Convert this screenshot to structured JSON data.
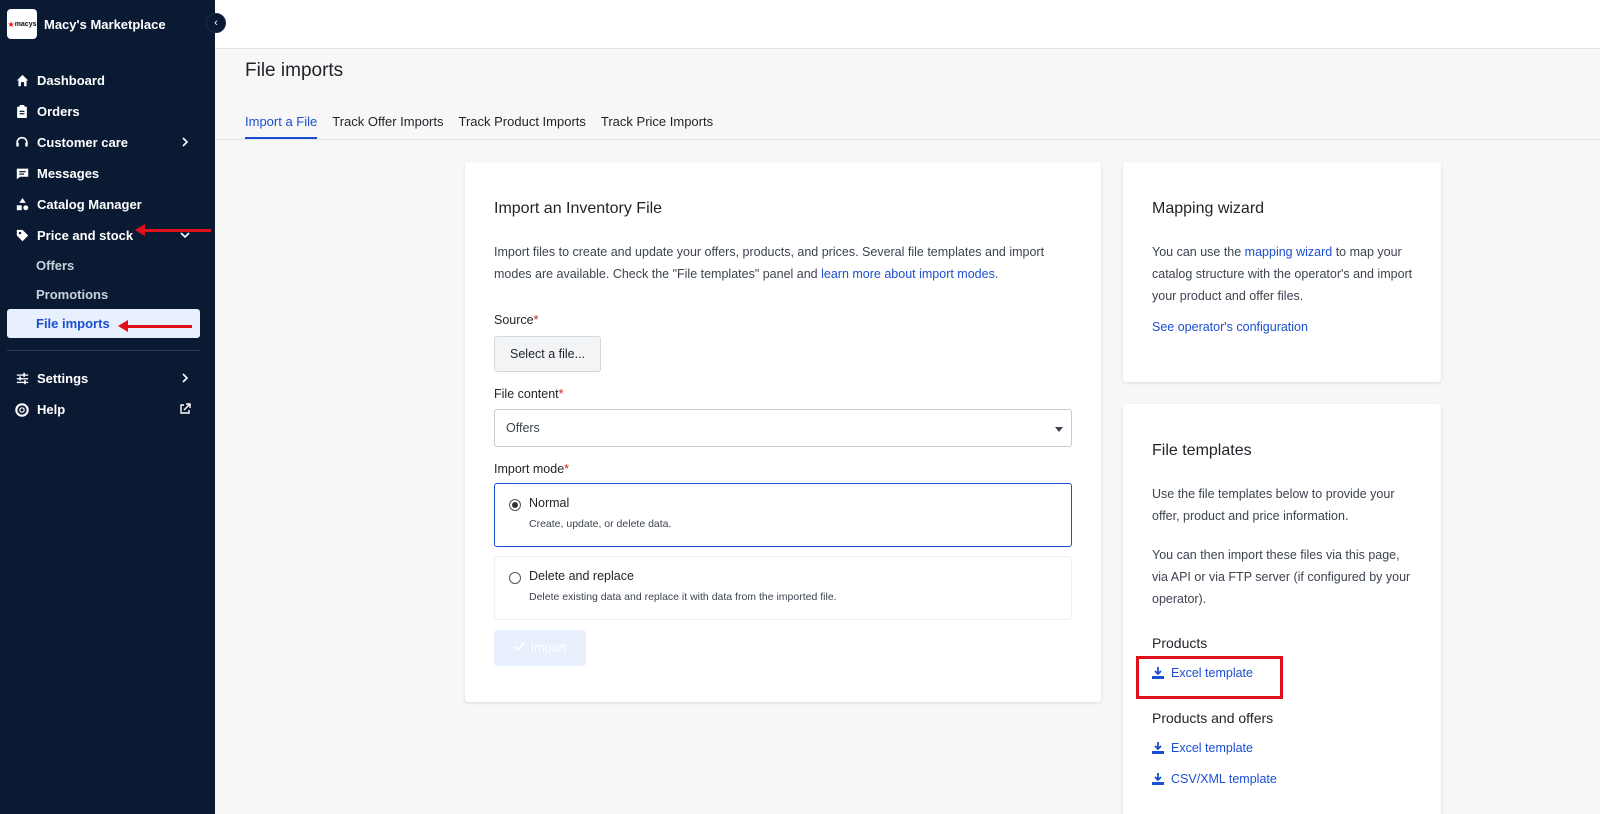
{
  "sidebar": {
    "brand_name": "Macy's Marketplace",
    "logo_text": "macys",
    "collapse_glyph": "‹",
    "items": [
      {
        "label": "Dashboard",
        "icon": "home-icon"
      },
      {
        "label": "Orders",
        "icon": "clipboard-icon"
      },
      {
        "label": "Customer care",
        "icon": "headset-icon",
        "has_chevron": true
      },
      {
        "label": "Messages",
        "icon": "chat-icon"
      },
      {
        "label": "Catalog Manager",
        "icon": "shapes-icon"
      },
      {
        "label": "Price and stock",
        "icon": "tag-icon",
        "expanded": true
      }
    ],
    "sub_items": [
      {
        "label": "Offers"
      },
      {
        "label": "Promotions"
      },
      {
        "label": "File imports",
        "active": true
      }
    ],
    "bottom_items": [
      {
        "label": "Settings",
        "icon": "sliders-icon",
        "has_chevron": true
      },
      {
        "label": "Help",
        "icon": "lifebuoy-icon",
        "external": true
      }
    ]
  },
  "page": {
    "title": "File imports",
    "tabs": [
      {
        "label": "Import a File",
        "active": true
      },
      {
        "label": "Track Offer Imports"
      },
      {
        "label": "Track Product Imports"
      },
      {
        "label": "Track Price Imports"
      }
    ]
  },
  "import_card": {
    "title": "Import an Inventory File",
    "desc_text": "Import files to create and update your offers, products, and prices. Several file templates and import modes are available. Check the \"File templates\" panel and ",
    "desc_link": "learn more about import modes",
    "desc_end": ".",
    "source_label": "Source",
    "required_mark": "*",
    "select_file_label": "Select a file...",
    "content_label": "File content",
    "content_value": "Offers",
    "mode_label": "Import mode",
    "modes": [
      {
        "title": "Normal",
        "desc": "Create, update, or delete data.",
        "selected": true
      },
      {
        "title": "Delete and replace",
        "desc": "Delete existing data and replace it with data from the imported file.",
        "selected": false
      }
    ],
    "import_button": "Import"
  },
  "mapping_card": {
    "title": "Mapping wizard",
    "text_before": "You can use the ",
    "link": "mapping wizard",
    "text_after": " to map your catalog structure with the operator's and import your product and offer files.",
    "config_link": "See operator's configuration"
  },
  "templates_card": {
    "title": "File templates",
    "para1": "Use the file templates below to provide your offer, product and price information.",
    "para2": "You can then import these files via this page, via API or via FTP server (if configured by your operator).",
    "groups": [
      {
        "heading": "Products",
        "links": [
          "Excel template"
        ]
      },
      {
        "heading": "Products and offers",
        "links": [
          "Excel template",
          "CSV/XML template"
        ]
      }
    ]
  },
  "colors": {
    "sidebar_bg": "#0b1a33",
    "accent": "#1b4fd1",
    "annotation_red": "#e0101a"
  }
}
